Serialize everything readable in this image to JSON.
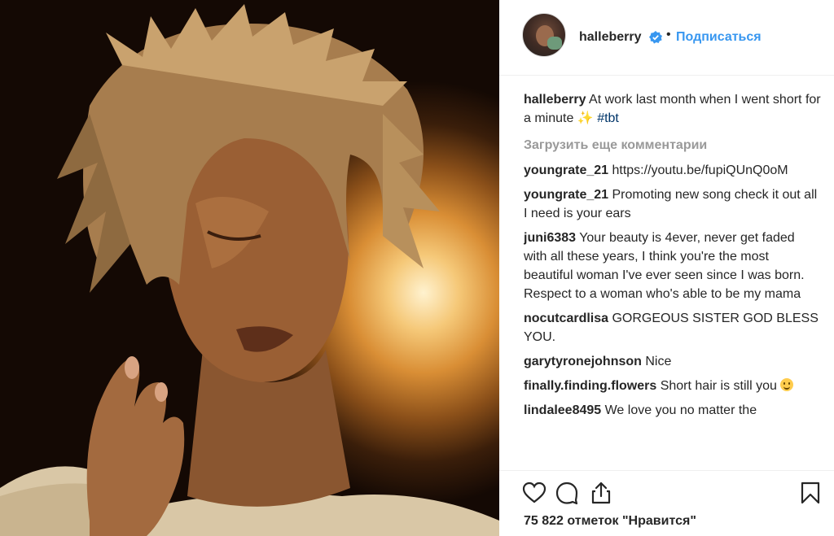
{
  "post": {
    "username": "halleberry",
    "separator": "•",
    "follow_label": "Подписаться"
  },
  "caption": {
    "username": "halleberry",
    "text": " At work last month when I went short for a minute ",
    "sparkle": "✨",
    "hashtag": "#tbt"
  },
  "load_more_label": "Загрузить еще комментарии",
  "comments": [
    {
      "username": "youngrate_21",
      "text": " https://youtu.be/fupiQUnQ0oM"
    },
    {
      "username": "youngrate_21",
      "text": " Promoting new song check it out all I need is your ears"
    },
    {
      "username": "juni6383",
      "text": " Your beauty is 4ever, never get faded with all these years, I think you're the most beautiful woman I've ever seen since I was born. Respect to a woman who's able to be my mama"
    },
    {
      "username": "nocutcardlisa",
      "text": " GORGEOUS SISTER GOD BLESS YOU."
    },
    {
      "username": "garytyronejohnson",
      "text": " Nice"
    },
    {
      "username": "finally.finding.flowers",
      "text": " Short hair is still you "
    },
    {
      "username": "lindalee8495",
      "text": " We love you no matter the"
    }
  ],
  "likes_label": "75 822 отметок \"Нравится\"",
  "icons": {
    "verified": "verified-badge-icon",
    "like": "heart-icon",
    "comment": "comment-bubble-icon",
    "share": "share-icon",
    "save": "bookmark-icon",
    "emoji": "smiling-face-icon"
  },
  "colors": {
    "link_blue": "#3897f0",
    "hashtag": "#003569",
    "muted": "#999999",
    "text": "#262626"
  }
}
